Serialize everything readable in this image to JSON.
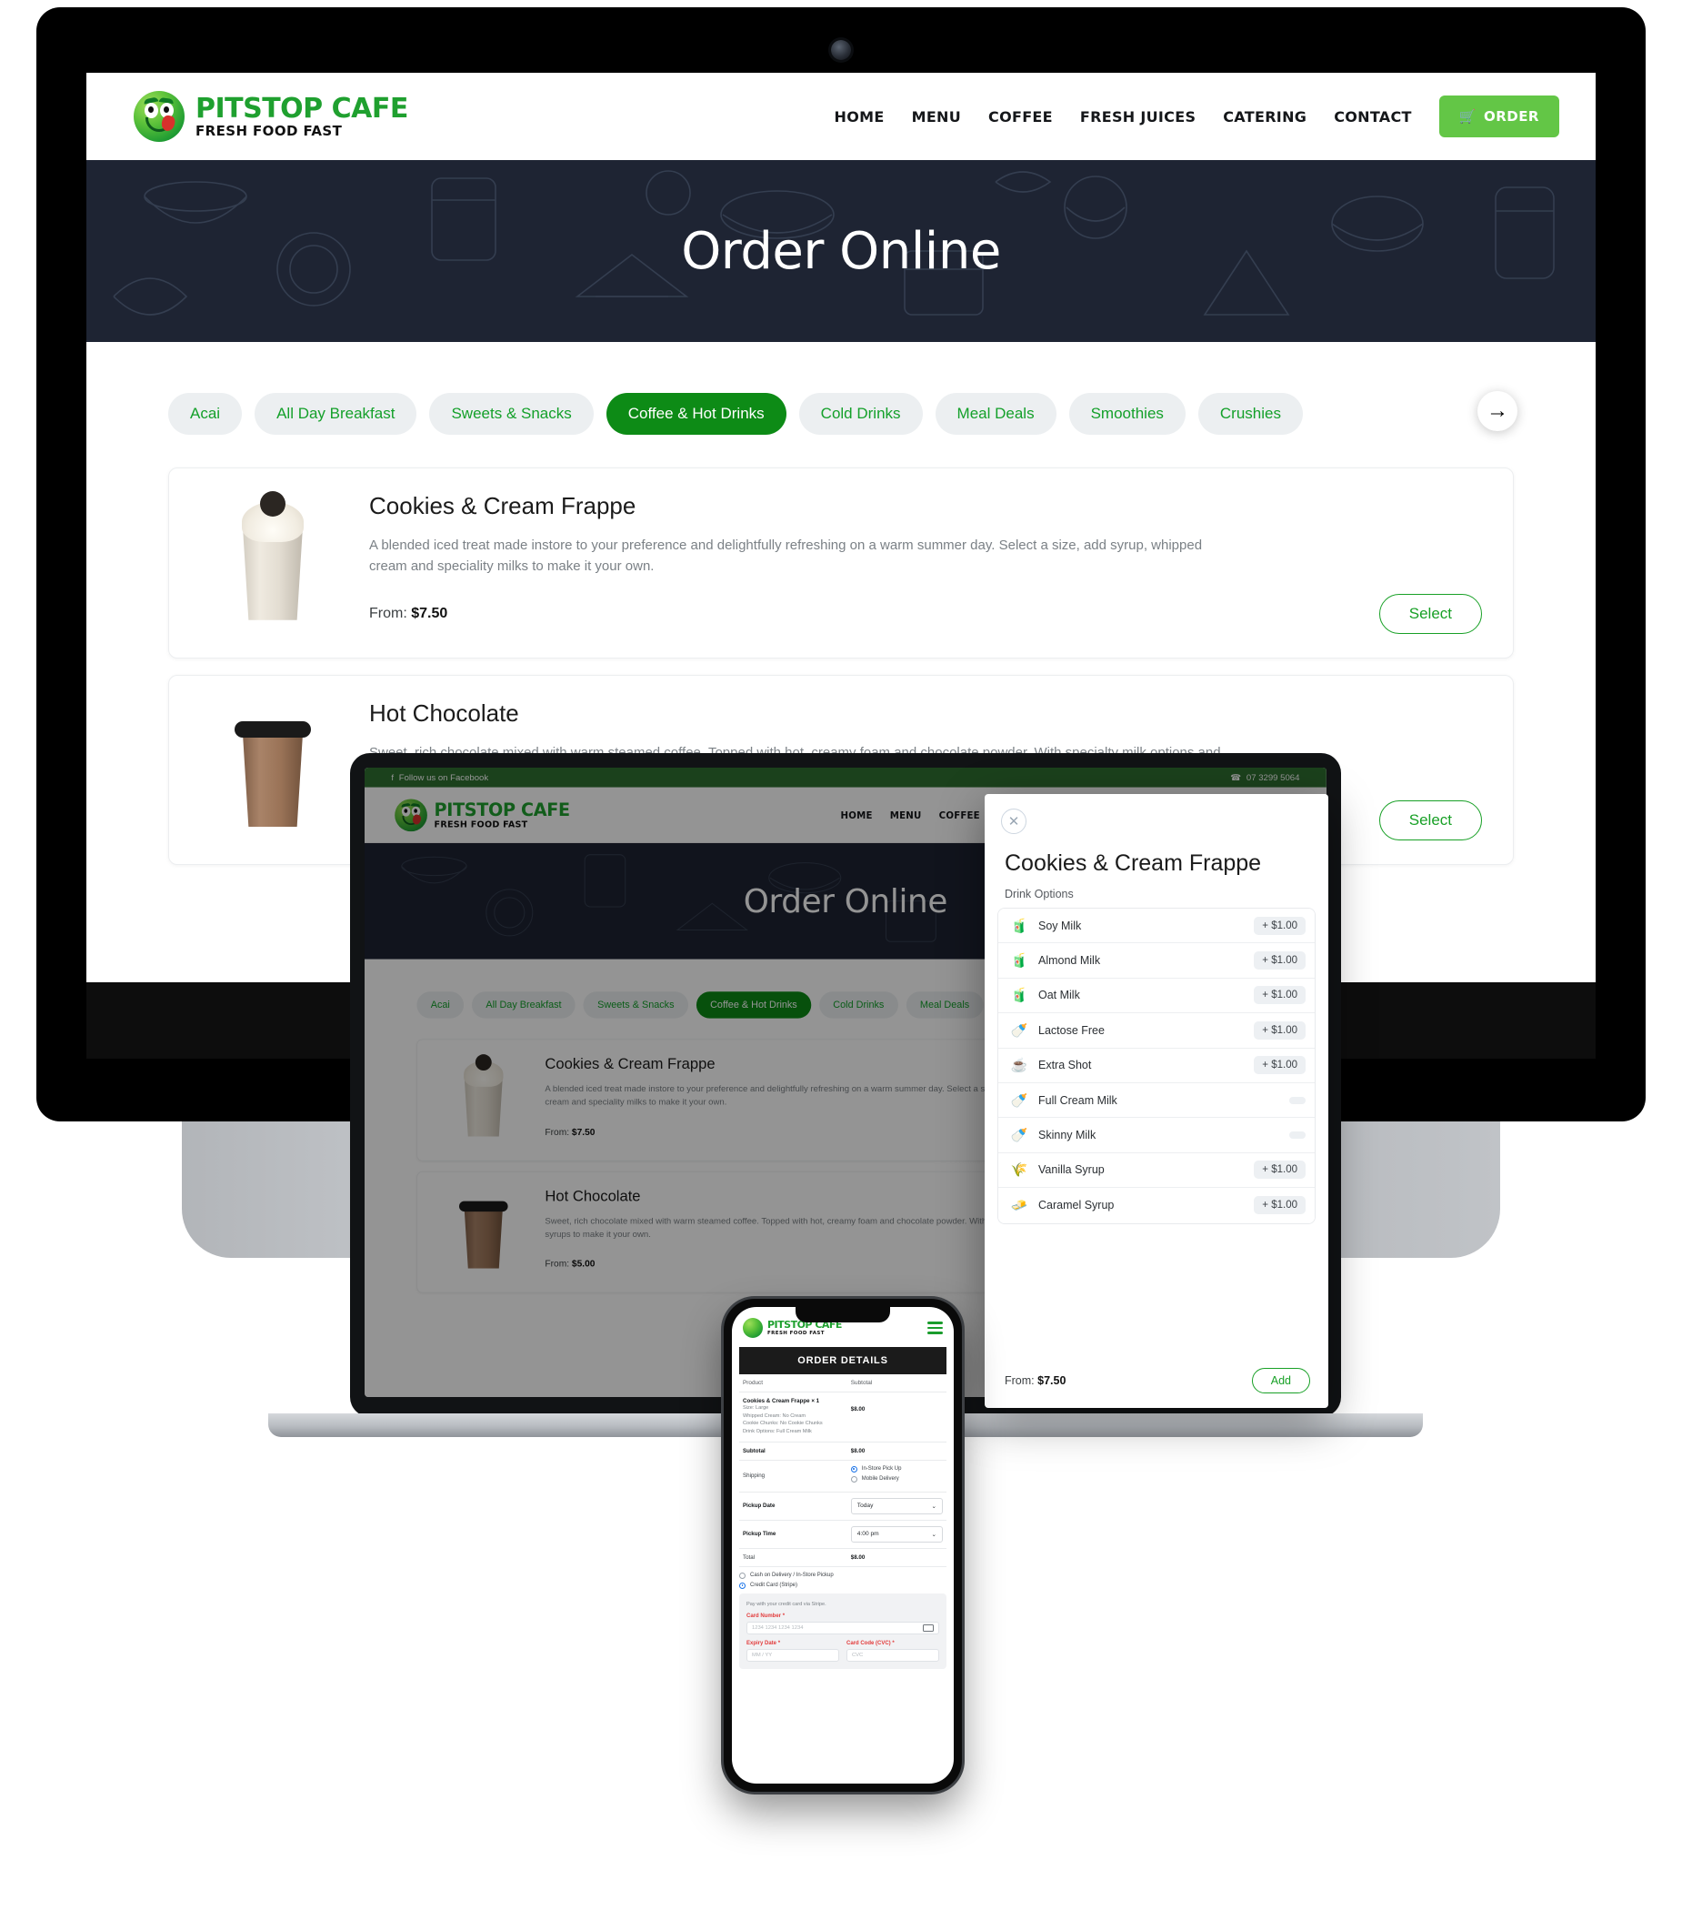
{
  "site": {
    "brand": {
      "title": "PITSTOP CAFE",
      "subtitle": "FRESH FOOD FAST"
    },
    "nav": [
      {
        "label": "HOME"
      },
      {
        "label": "MENU"
      },
      {
        "label": "COFFEE"
      },
      {
        "label": "FRESH JUICES"
      },
      {
        "label": "CATERING"
      },
      {
        "label": "CONTACT"
      }
    ],
    "order_button": {
      "label": "ORDER",
      "icon": "basket-icon"
    },
    "hero_title": "Order Online",
    "topbar": {
      "facebook": "Follow us on Facebook",
      "phone": "07 3299 5064"
    },
    "categories": [
      {
        "label": "Acai",
        "active": false
      },
      {
        "label": "All Day Breakfast",
        "active": false
      },
      {
        "label": "Sweets & Snacks",
        "active": false
      },
      {
        "label": "Coffee & Hot Drinks",
        "active": true
      },
      {
        "label": "Cold Drinks",
        "active": false
      },
      {
        "label": "Meal Deals",
        "active": false
      },
      {
        "label": "Smoothies",
        "active": false
      },
      {
        "label": "Crushies",
        "active": false
      }
    ],
    "next_arrow": "→",
    "products": [
      {
        "name": "Cookies & Cream Frappe",
        "description": "A blended iced treat made instore to your preference and delightfully refreshing on a warm summer day. Select a size, add syrup, whipped cream and speciality milks to make it your own.",
        "price_label": "From:",
        "price": "$7.50",
        "button": "Select"
      },
      {
        "name": "Hot Chocolate",
        "description": "Sweet, rich chocolate mixed with warm steamed coffee. Topped with hot, creamy foam and chocolate powder. With specialty milk options and syrups to make it your own.",
        "price_label": "From:",
        "price": "$5.00",
        "button": "Select"
      }
    ]
  },
  "modal": {
    "close_icon": "close-icon",
    "title": "Cookies & Cream Frappe",
    "section_label": "Drink Options",
    "options": [
      {
        "name": "Soy Milk",
        "price": "+ $1.00",
        "icon": "🧃"
      },
      {
        "name": "Almond Milk",
        "price": "+ $1.00",
        "icon": "🧃"
      },
      {
        "name": "Oat Milk",
        "price": "+ $1.00",
        "icon": "🧃"
      },
      {
        "name": "Lactose Free",
        "price": "+ $1.00",
        "icon": "🍼"
      },
      {
        "name": "Extra Shot",
        "price": "+ $1.00",
        "icon": "☕"
      },
      {
        "name": "Full Cream Milk",
        "price": "",
        "icon": "🍼"
      },
      {
        "name": "Skinny Milk",
        "price": "",
        "icon": "🍼"
      },
      {
        "name": "Vanilla Syrup",
        "price": "+ $1.00",
        "icon": "🌾"
      },
      {
        "name": "Caramel Syrup",
        "price": "+ $1.00",
        "icon": "🧈"
      }
    ],
    "price_label": "From:",
    "price": "$7.50",
    "add_button": "Add"
  },
  "phone": {
    "menu_icon": "hamburger-icon",
    "header": "ORDER DETAILS",
    "columns": {
      "product": "Product",
      "subtotal": "Subtotal"
    },
    "line_item": {
      "name": "Cookies & Cream Frappe",
      "qty": "× 1",
      "amount": "$8.00",
      "details": [
        "Size: Large",
        "Whipped Cream: No Cream",
        "Cookie Chunks: No Cookie Chunks",
        "Drink Options: Full Cream Milk"
      ]
    },
    "subtotal": {
      "label": "Subtotal",
      "value": "$8.00"
    },
    "shipping": {
      "label": "Shipping",
      "options": [
        {
          "label": "In-Store Pick Up",
          "selected": true
        },
        {
          "label": "Mobile Delivery",
          "selected": false
        }
      ]
    },
    "pickup_date": {
      "label": "Pickup Date",
      "value": "Today"
    },
    "pickup_time": {
      "label": "Pickup Time",
      "value": "4:00 pm"
    },
    "total": {
      "label": "Total",
      "value": "$8.00"
    },
    "payment": {
      "options": [
        {
          "label": "Cash on Delivery / In-Store Pickup",
          "selected": false
        },
        {
          "label": "Credit Card (Stripe)",
          "selected": true
        }
      ],
      "note": "Pay with your credit card via Stripe.",
      "card_number": {
        "label": "Card Number",
        "required": "*",
        "placeholder": "1234 1234 1234 1234"
      },
      "expiry": {
        "label": "Expiry Date",
        "required": "*",
        "placeholder": "MM / YY"
      },
      "cvc": {
        "label": "Card Code (CVC)",
        "required": "*",
        "placeholder": "CVC"
      }
    }
  },
  "colors": {
    "brand_green": "#1fa02f",
    "accent_green": "#63c646",
    "active_tab": "#0d8b16",
    "hero_navy": "#1e2433",
    "topbar_green": "#2f7031"
  }
}
